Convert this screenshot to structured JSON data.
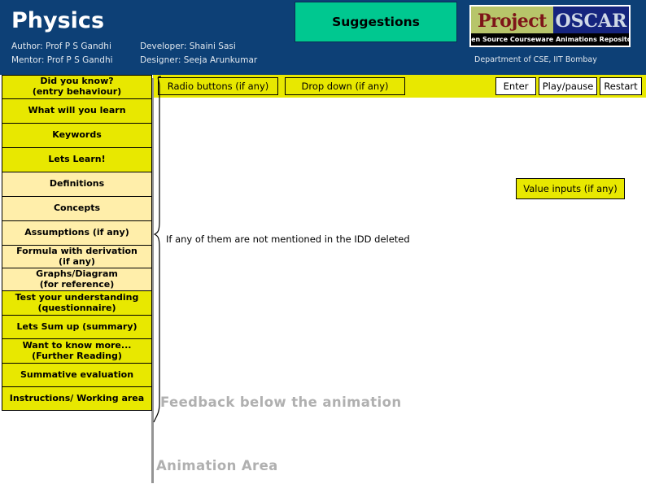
{
  "header": {
    "subject_title": "Physics",
    "credits": {
      "author": "Author: Prof P S Gandhi",
      "mentor": "Mentor: Prof P S Gandhi",
      "developer": "Developer: Shaini Sasi",
      "designer": "Designer: Seeja Arunkumar"
    },
    "suggestions_label": "Suggestions",
    "logo": {
      "word_project": "Project",
      "word_oscar": "OSCAR",
      "tagline": "Open Source Courseware Animations Repository"
    },
    "department": "Department of CSE, IIT Bombay",
    "colors": {
      "header_background": "#0d4076",
      "suggestions_background": "#00c890",
      "logo_project_background": "#b7c56a",
      "logo_project_text": "#7e1518",
      "logo_oscar_background": "#15247e",
      "logo_oscar_text": "#cfd8e6"
    }
  },
  "toolbar": {
    "radio_placeholder": "Radio buttons (if any)",
    "dropdown_placeholder": "Drop down (if any)",
    "enter_label": "Enter",
    "play_pause_label": "Play/pause",
    "restart_label": "Restart",
    "background": "#e8e800"
  },
  "sidebar": {
    "items": [
      {
        "label": "Did you know?\n(entry behaviour)",
        "style": "bright",
        "height": 30
      },
      {
        "label": "What will you learn",
        "style": "bright",
        "height": 30
      },
      {
        "label": "Keywords",
        "style": "bright",
        "height": 30
      },
      {
        "label": "Lets Learn!",
        "style": "bright",
        "height": 30
      },
      {
        "label": "Definitions",
        "style": "cream",
        "height": 30
      },
      {
        "label": "Concepts",
        "style": "cream",
        "height": 30
      },
      {
        "label": "Assumptions  (if any)",
        "style": "cream",
        "height": 30
      },
      {
        "label": "Formula with derivation\n(if any)",
        "style": "cream",
        "height": 28
      },
      {
        "label": "Graphs/Diagram\n(for reference)",
        "style": "cream",
        "height": 28
      },
      {
        "label": "Test your understanding\n(questionnaire)",
        "style": "bright",
        "height": 30
      },
      {
        "label": "Lets Sum up (summary)",
        "style": "bright",
        "height": 29
      },
      {
        "label": "Want to know more...\n(Further Reading)",
        "style": "bright",
        "height": 30
      },
      {
        "label": "Summative evaluation",
        "style": "bright",
        "height": 29
      },
      {
        "label": "Instructions/ Working area",
        "style": "bright",
        "height": 29
      }
    ],
    "colors": {
      "bright": "#e8e800",
      "cream": "#ffeeaa",
      "border": "#000000"
    }
  },
  "main": {
    "value_inputs_label": "Value inputs (if any)",
    "idd_note": "If any of them are not mentioned in the IDD deleted",
    "feedback_label": "Feedback below the animation",
    "animation_label": "Animation Area",
    "ghost_text_color": "#b0b0b0"
  }
}
